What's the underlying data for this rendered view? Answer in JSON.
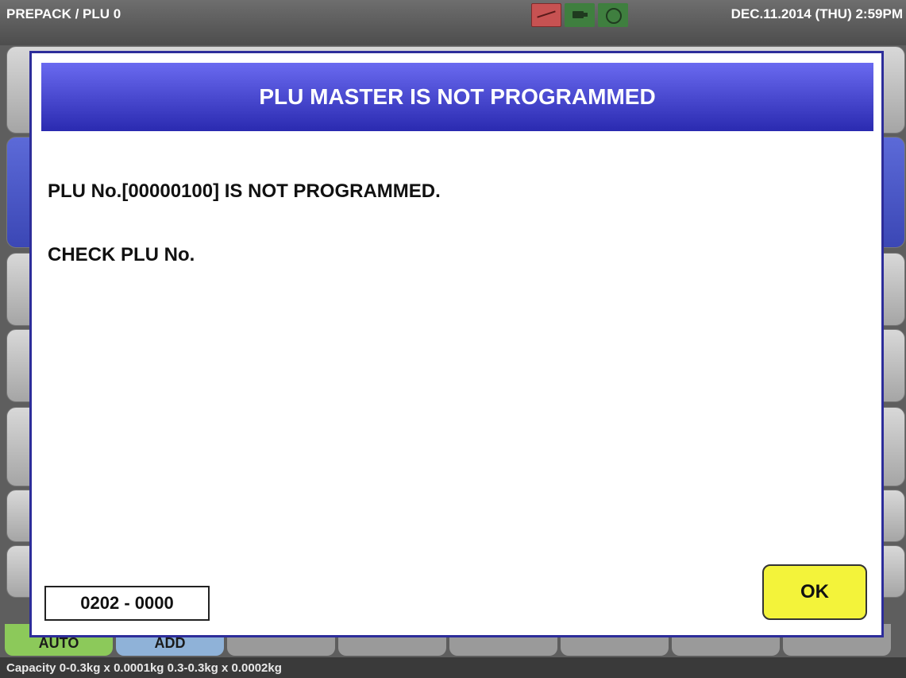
{
  "topbar": {
    "title": "PREPACK / PLU 0",
    "datetime": "DEC.11.2014 (THU)  2:59PM",
    "icons": [
      "paper-error-icon",
      "battery-icon",
      "network-icon"
    ]
  },
  "dialog": {
    "header": "PLU MASTER IS NOT PROGRAMMED",
    "message_line1": "PLU No.[00000100] IS NOT PROGRAMMED.",
    "message_line2": "CHECK PLU No.",
    "code": "0202 - 0000",
    "ok_label": "OK"
  },
  "bottom_keys": [
    {
      "label": "AUTO",
      "color": "#8cc95a"
    },
    {
      "label": "ADD",
      "color": "#8fb2d8"
    },
    {
      "label": ""
    },
    {
      "label": ""
    },
    {
      "label": ""
    },
    {
      "label": ""
    },
    {
      "label": ""
    },
    {
      "label": ""
    }
  ],
  "footer": {
    "capacity": "Capacity 0-0.3kg x 0.0001kg  0.3-0.3kg x 0.0002kg"
  },
  "colors": {
    "header_blue": "#2a2ab0",
    "ok_yellow": "#f3f33a",
    "dialog_border": "#2d2d9a"
  }
}
